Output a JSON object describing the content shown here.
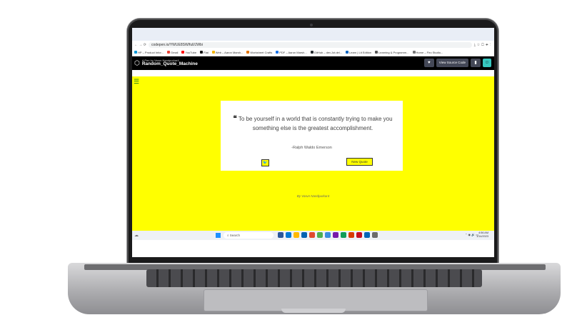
{
  "browser": {
    "url": "codepen.io/YWUE8SW/full/JWbi",
    "bookmarks": [
      "HP – Product Infor...",
      "Gmail",
      "YouTube",
      "Flat",
      "Web – Aaron Marsh...",
      "Worksheet Crafts",
      "PDF – Aaron Marsh...",
      "GitHub – dev.Jot.del...",
      "Learn | Lit Edition",
      "Learning & Programm...",
      "Home – Firo Studio..."
    ]
  },
  "codepen": {
    "by_line": "A Pen by Varun Nandpurkar4",
    "pen_title": "Random_Quote_Machine",
    "view_source_label": "View Source Code",
    "heart_icon": "heart-icon",
    "avatar_glyph": "☺"
  },
  "app": {
    "background_color": "#ffff00",
    "quote_mark": "❝",
    "quote": "To be yourself in a world that is constantly trying to make you something else is the greatest accomplishment.",
    "author": "-Ralph Waldo Emerson",
    "tweet_glyph": "🐦",
    "new_quote_label": "New Quote",
    "credit": "By Varun Nandpurkar4"
  },
  "taskbar": {
    "search_placeholder": "Search",
    "time": "4:56 AM",
    "date": "1/14/2023",
    "app_colors": [
      "#2b579a",
      "#0078d4",
      "#ffb900",
      "#0063b1",
      "#e04a2e",
      "#4caf50",
      "#3a8dde",
      "#7719aa",
      "#0f9d58",
      "#d83b01",
      "#c50f1f",
      "#0066b8",
      "#6b6b6b"
    ]
  }
}
